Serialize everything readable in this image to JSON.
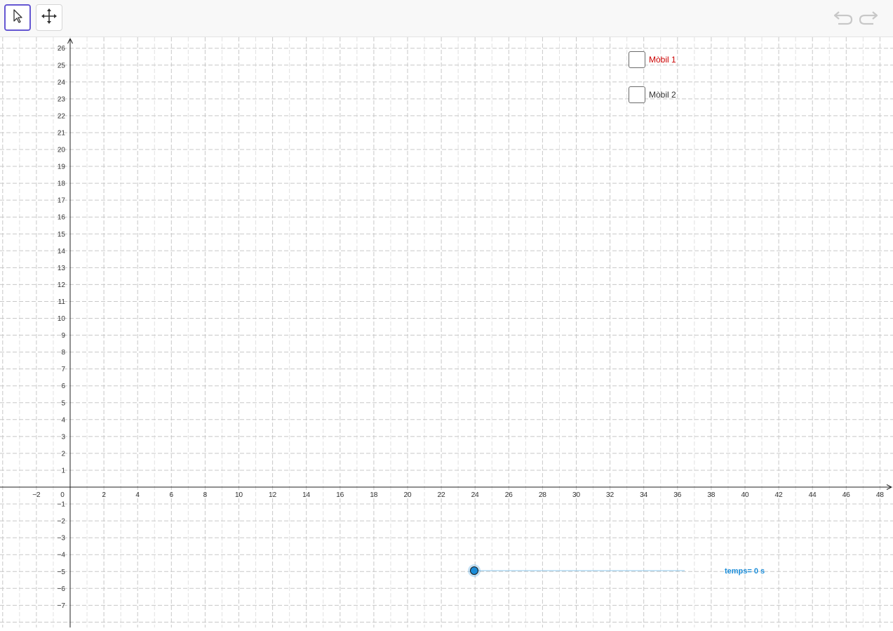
{
  "toolbar": {
    "tools": [
      {
        "name": "move-tool",
        "icon": "arrow-cursor-icon",
        "active": true
      },
      {
        "name": "move-graphics-view-tool",
        "icon": "four-arrows-move-icon",
        "active": false
      }
    ],
    "undo_icon": "undo-icon",
    "redo_icon": "redo-icon"
  },
  "graphics": {
    "x_ticks": [
      "−2",
      "0",
      "2",
      "4",
      "6",
      "8",
      "10",
      "12",
      "14",
      "16",
      "18",
      "20",
      "22",
      "24",
      "26",
      "28",
      "30",
      "32",
      "34",
      "36",
      "38",
      "40",
      "42",
      "44",
      "46",
      "48"
    ],
    "y_ticks": [
      "26",
      "25",
      "24",
      "23",
      "22",
      "21",
      "20",
      "19",
      "18",
      "17",
      "16",
      "15",
      "14",
      "13",
      "12",
      "11",
      "10",
      "9",
      "8",
      "7",
      "6",
      "5",
      "4",
      "3",
      "2",
      "1",
      "−1",
      "−2",
      "−3",
      "−4",
      "−5",
      "−6",
      "−7"
    ],
    "grid": true,
    "grid_style": "dashed"
  },
  "checkboxes": [
    {
      "label": "Mòbil 1",
      "checked": false,
      "color": "#cc0000"
    },
    {
      "label": "Mòbil 2",
      "checked": false,
      "color": "#333333"
    }
  ],
  "slider": {
    "label": "temps= 0 s",
    "value": 0,
    "fill": 0,
    "color": "#1a8cd8"
  }
}
